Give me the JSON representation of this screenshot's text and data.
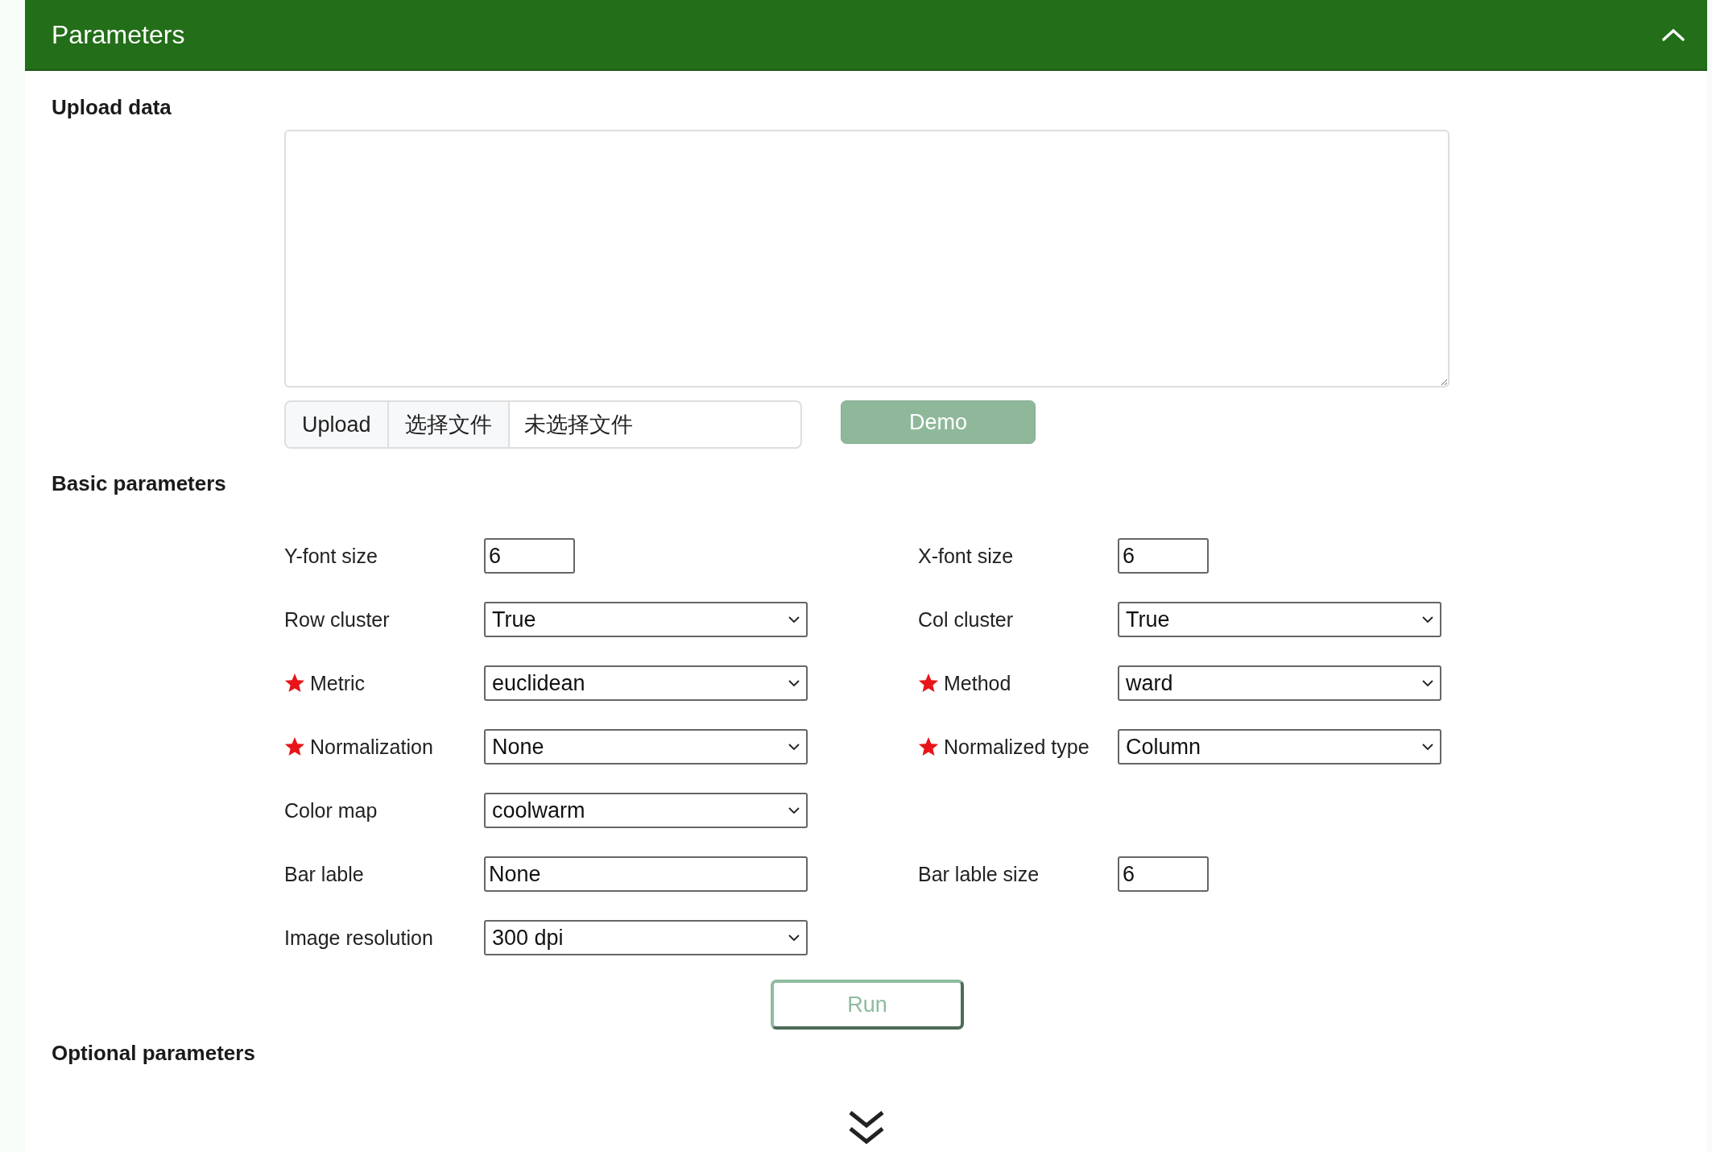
{
  "header": {
    "title": "Parameters",
    "expanded": true
  },
  "upload": {
    "heading": "Upload data",
    "upload_label": "Upload",
    "choose_button": "选择文件",
    "file_status": "未选择文件",
    "demo_button": "Demo"
  },
  "basic": {
    "heading": "Basic parameters",
    "rows": [
      {
        "left": {
          "label": "Y-font size",
          "value": "6",
          "kind": "number",
          "required": false
        },
        "right": {
          "label": "X-font size",
          "value": "6",
          "kind": "number",
          "required": false
        }
      },
      {
        "left": {
          "label": "Row cluster",
          "value": "True",
          "kind": "select",
          "required": false
        },
        "right": {
          "label": "Col cluster",
          "value": "True",
          "kind": "select",
          "required": false
        }
      },
      {
        "left": {
          "label": "Metric",
          "value": "euclidean",
          "kind": "select",
          "required": true
        },
        "right": {
          "label": "Method",
          "value": "ward",
          "kind": "select",
          "required": true
        }
      },
      {
        "left": {
          "label": "Normalization",
          "value": "None",
          "kind": "select",
          "required": true
        },
        "right": {
          "label": "Normalized type",
          "value": "Column",
          "kind": "select",
          "required": true
        }
      },
      {
        "left": {
          "label": "Color map",
          "value": "coolwarm",
          "kind": "select",
          "required": false
        }
      },
      {
        "left": {
          "label": "Bar lable",
          "value": "None",
          "kind": "text",
          "required": false
        },
        "right": {
          "label": "Bar lable size",
          "value": "6",
          "kind": "number",
          "required": false
        }
      },
      {
        "left": {
          "label": "Image resolution",
          "value": "300 dpi",
          "kind": "select",
          "required": false
        }
      }
    ]
  },
  "run_button": "Run",
  "optional": {
    "heading": "Optional parameters",
    "expanded": false
  }
}
